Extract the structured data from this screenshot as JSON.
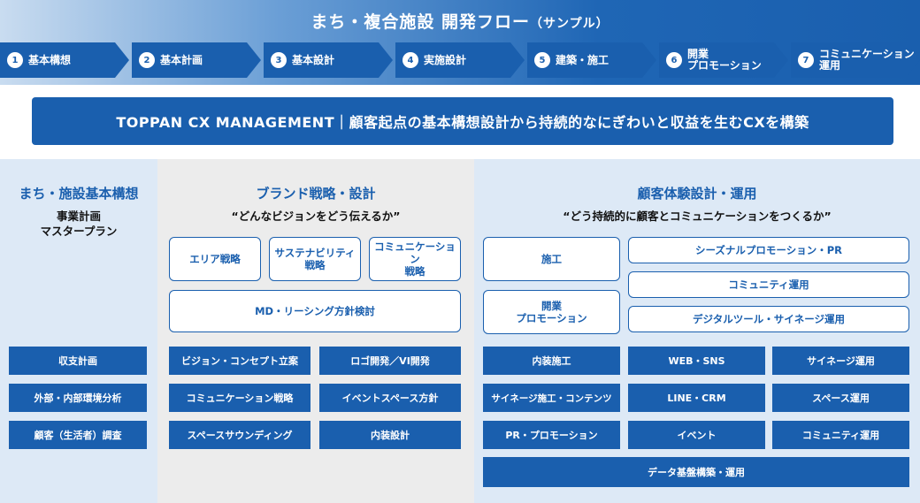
{
  "header": {
    "title": "まち・複合施設 開発フロー",
    "title_suffix": "（サンプル）"
  },
  "steps": [
    {
      "num": "1",
      "label": "基本構想"
    },
    {
      "num": "2",
      "label": "基本計画"
    },
    {
      "num": "3",
      "label": "基本設計"
    },
    {
      "num": "4",
      "label": "実施設計"
    },
    {
      "num": "5",
      "label": "建築・施工"
    },
    {
      "num": "6",
      "label": "開業\nプロモーション"
    },
    {
      "num": "7",
      "label": "コミュニケーション\n運用"
    }
  ],
  "banner": "TOPPAN CX MANAGEMENT｜顧客起点の基本構想設計から持続的なにぎわいと収益を生むCXを構築",
  "col1": {
    "title": "まち・施設基本構想",
    "sub": "事業計画\nマスタープラン",
    "items": [
      "収支計画",
      "外部・内部環境分析",
      "顧客（生活者）調査"
    ]
  },
  "col2": {
    "title": "ブランド戦略・設計",
    "sub": "“どんなビジョンをどう伝えるか”",
    "white": [
      "エリア戦略",
      "サステナビリティ\n戦略",
      "コミュニケーション\n戦略",
      "MD・リーシング方針検討"
    ],
    "items": [
      "ビジョン・コンセプト立案",
      "ロゴ開発／VI開発",
      "コミュニケーション戦略",
      "イベントスペース方針",
      "スペースサウンディング",
      "内装設計"
    ]
  },
  "col3": {
    "title": "顧客体験設計・運用",
    "sub": "“どう持続的に顧客とコミュニケーションをつくるか”",
    "white": [
      "施工",
      "開業\nプロモーション",
      "シーズナルプロモーション・PR",
      "コミュニティ運用",
      "デジタルツール・サイネージ運用"
    ],
    "items": [
      "内装施工",
      "WEB・SNS",
      "サイネージ運用",
      "サイネージ施工・コンテンツ",
      "LINE・CRM",
      "スペース運用",
      "PR・プロモーション",
      "イベント",
      "コミュニティ運用",
      "データ基盤構築・運用"
    ]
  }
}
